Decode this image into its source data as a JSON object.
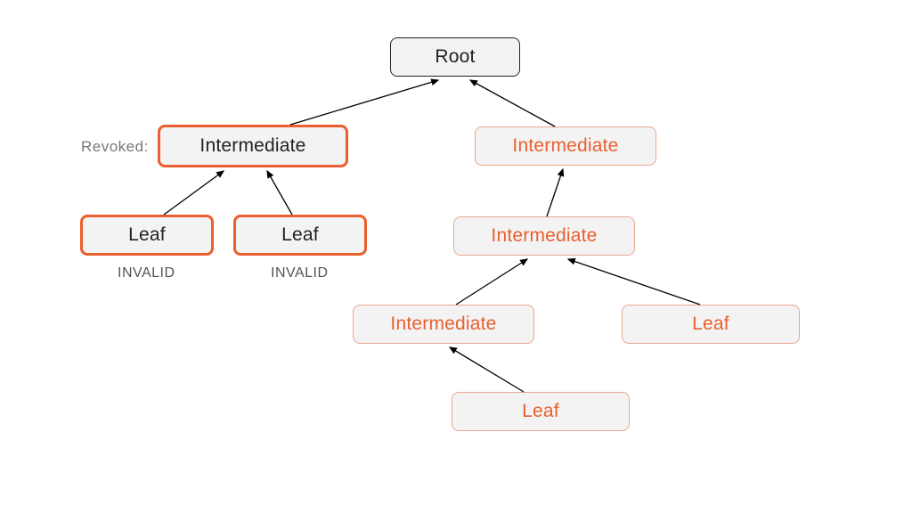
{
  "labels": {
    "revoked": "Revoked:",
    "invalid_left": "INVALID",
    "invalid_right": "INVALID"
  },
  "nodes": {
    "root": "Root",
    "int_revoked": "Intermediate",
    "int_r1": "Intermediate",
    "leaf_rev_a": "Leaf",
    "leaf_rev_b": "Leaf",
    "int_r2": "Intermediate",
    "int_r3": "Intermediate",
    "leaf_r2": "Leaf",
    "leaf_r3": "Leaf"
  },
  "colors": {
    "accent": "#e95f2f",
    "accent_light": "#e8a88e",
    "node_bg": "#f3f3f3",
    "text_dark": "#222222",
    "text_muted": "#777777"
  }
}
